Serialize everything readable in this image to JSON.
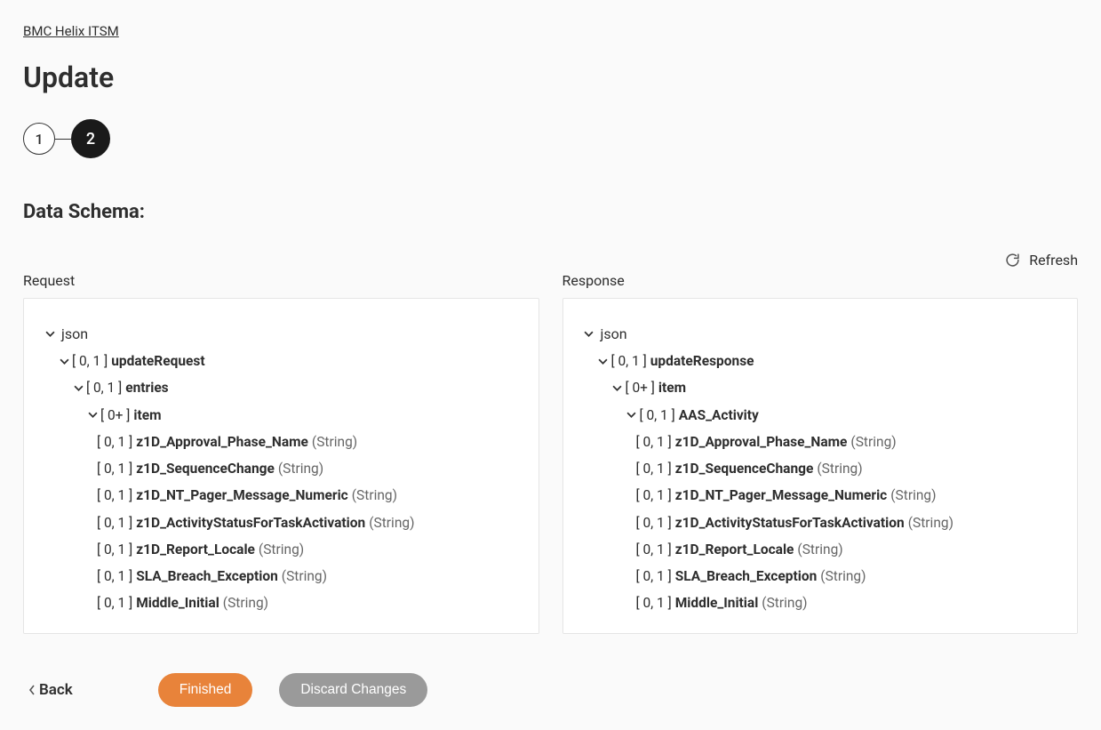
{
  "breadcrumb": {
    "label": "BMC Helix ITSM"
  },
  "page": {
    "title": "Update"
  },
  "stepper": {
    "steps": [
      "1",
      "2"
    ],
    "active_index": 1
  },
  "section": {
    "title": "Data Schema:"
  },
  "refresh": {
    "label": "Refresh"
  },
  "panels": {
    "request_label": "Request",
    "response_label": "Response"
  },
  "request_tree": {
    "root": "json",
    "n0": {
      "card": "[ 0, 1 ]",
      "name": "updateRequest"
    },
    "n1": {
      "card": "[ 0, 1 ]",
      "name": "entries"
    },
    "n2": {
      "card": "[ 0+ ]",
      "name": "item"
    },
    "fields": [
      {
        "card": "[ 0, 1 ]",
        "name": "z1D_Approval_Phase_Name",
        "type": "(String)"
      },
      {
        "card": "[ 0, 1 ]",
        "name": "z1D_SequenceChange",
        "type": "(String)"
      },
      {
        "card": "[ 0, 1 ]",
        "name": "z1D_NT_Pager_Message_Numeric",
        "type": "(String)"
      },
      {
        "card": "[ 0, 1 ]",
        "name": "z1D_ActivityStatusForTaskActivation",
        "type": "(String)"
      },
      {
        "card": "[ 0, 1 ]",
        "name": "z1D_Report_Locale",
        "type": "(String)"
      },
      {
        "card": "[ 0, 1 ]",
        "name": "SLA_Breach_Exception",
        "type": "(String)"
      },
      {
        "card": "[ 0, 1 ]",
        "name": "Middle_Initial",
        "type": "(String)"
      }
    ]
  },
  "response_tree": {
    "root": "json",
    "n0": {
      "card": "[ 0, 1 ]",
      "name": "updateResponse"
    },
    "n1": {
      "card": "[ 0+ ]",
      "name": "item"
    },
    "n2": {
      "card": "[ 0, 1 ]",
      "name": "AAS_Activity"
    },
    "fields": [
      {
        "card": "[ 0, 1 ]",
        "name": "z1D_Approval_Phase_Name",
        "type": "(String)"
      },
      {
        "card": "[ 0, 1 ]",
        "name": "z1D_SequenceChange",
        "type": "(String)"
      },
      {
        "card": "[ 0, 1 ]",
        "name": "z1D_NT_Pager_Message_Numeric",
        "type": "(String)"
      },
      {
        "card": "[ 0, 1 ]",
        "name": "z1D_ActivityStatusForTaskActivation",
        "type": "(String)"
      },
      {
        "card": "[ 0, 1 ]",
        "name": "z1D_Report_Locale",
        "type": "(String)"
      },
      {
        "card": "[ 0, 1 ]",
        "name": "SLA_Breach_Exception",
        "type": "(String)"
      },
      {
        "card": "[ 0, 1 ]",
        "name": "Middle_Initial",
        "type": "(String)"
      }
    ]
  },
  "footer": {
    "back": "Back",
    "finished": "Finished",
    "discard": "Discard Changes"
  }
}
